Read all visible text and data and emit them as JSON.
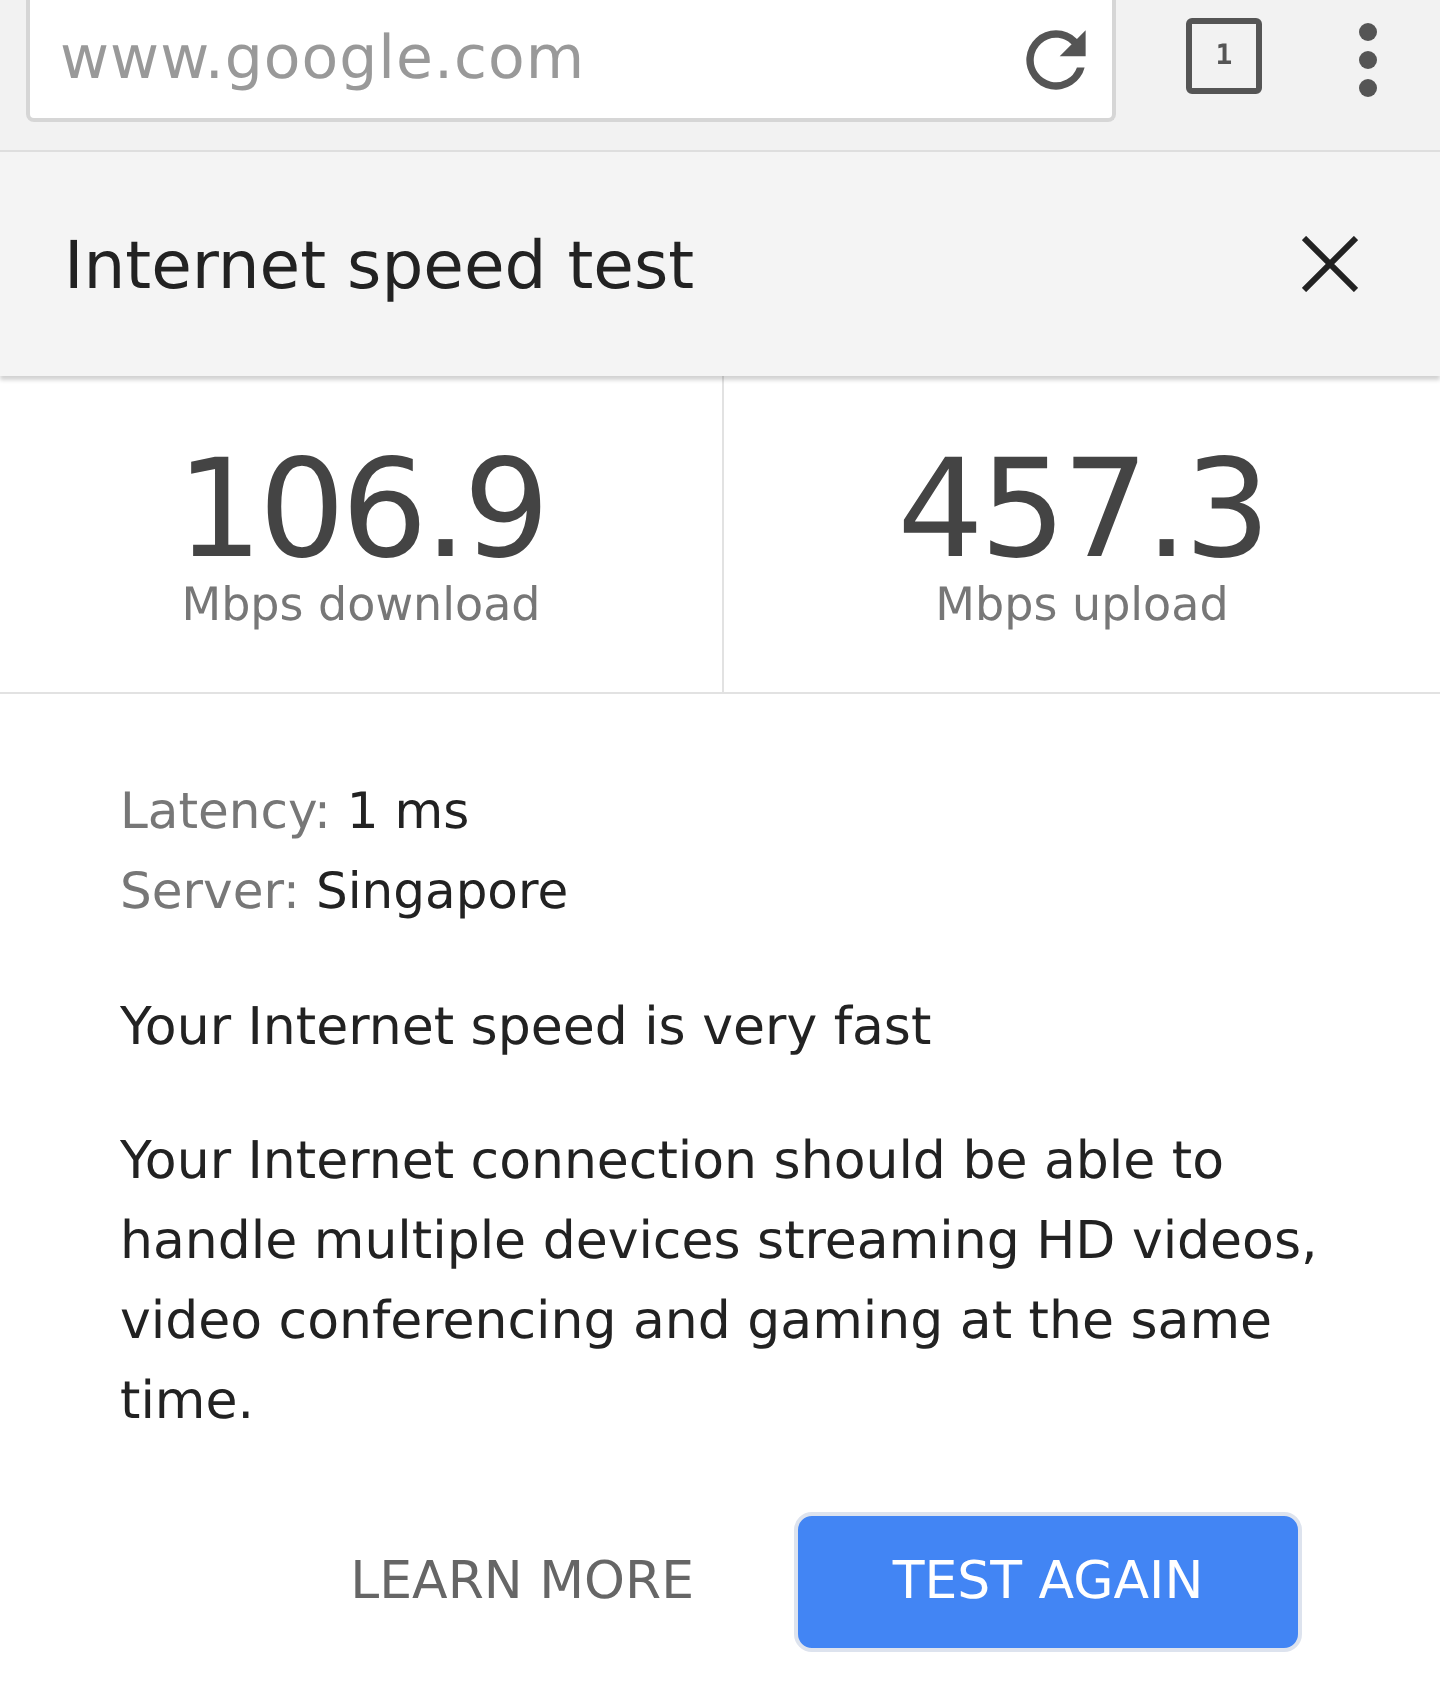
{
  "browser": {
    "url": "www.google.com",
    "tab_count": "1"
  },
  "card": {
    "title": "Internet speed test",
    "results": [
      {
        "value": "106.9",
        "label": "Mbps download"
      },
      {
        "value": "457.3",
        "label": "Mbps upload"
      }
    ],
    "details": [
      {
        "label": "Latency:",
        "value": "1 ms"
      },
      {
        "label": "Server:",
        "value": "Singapore"
      }
    ],
    "verdict": "Your Internet speed is very fast",
    "description": "Your Internet connection should be able to handle multiple devices streaming HD videos, video conferencing and gaming at the same time.",
    "buttons": [
      {
        "label": "LEARN MORE",
        "kind": "text"
      },
      {
        "label": "TEST AGAIN",
        "kind": "primary"
      }
    ]
  }
}
